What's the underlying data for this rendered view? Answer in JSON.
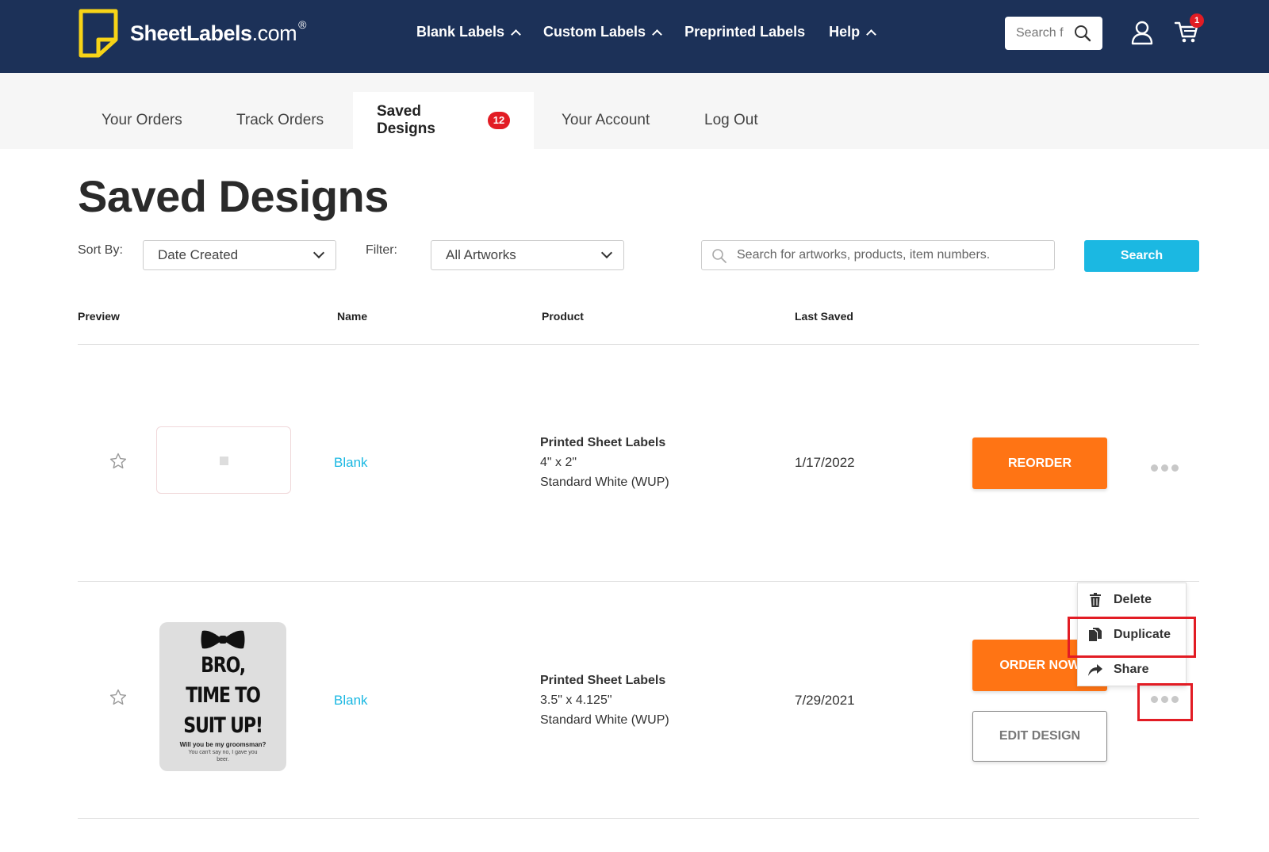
{
  "brand": {
    "name": "SheetLabels",
    "tld": ".com",
    "reg": "®"
  },
  "nav": [
    {
      "label": "Blank Labels",
      "caret": true
    },
    {
      "label": "Custom Labels",
      "caret": true
    },
    {
      "label": "Preprinted Labels",
      "caret": false
    },
    {
      "label": "Help",
      "caret": true
    }
  ],
  "header": {
    "search_placeholder": "Search f",
    "cart_count": "1"
  },
  "tabs": {
    "orders": "Your Orders",
    "track": "Track Orders",
    "saved": "Saved Designs",
    "saved_count": "12",
    "account": "Your Account",
    "logout": "Log Out"
  },
  "page": {
    "title": "Saved Designs"
  },
  "filters": {
    "sort_label": "Sort By:",
    "sort_value": "Date Created",
    "filter_label": "Filter:",
    "filter_value": "All Artworks",
    "search_placeholder": "Search for artworks, products, item numbers.",
    "search_button": "Search"
  },
  "table": {
    "headers": {
      "preview": "Preview",
      "name": "Name",
      "product": "Product",
      "last_saved": "Last Saved"
    },
    "rows": [
      {
        "name": "Blank",
        "product_title": "Printed Sheet Labels",
        "product_size": "4\" x 2\"",
        "product_material": "Standard White (WUP)",
        "last_saved": "1/17/2022",
        "primary_action": "REORDER"
      },
      {
        "name": "Blank",
        "product_title": "Printed Sheet Labels",
        "product_size": "3.5\" x 4.125\"",
        "product_material": "Standard White (WUP)",
        "last_saved": "7/29/2021",
        "primary_action": "ORDER NOW",
        "secondary_action": "EDIT DESIGN",
        "art": {
          "headline_1": "BRO,",
          "headline_2": "TIME TO",
          "headline_3": "SUIT UP!",
          "sub_1": "Will you be my groomsman?",
          "sub_2": "You can't say no, I gave you beer."
        }
      }
    ]
  },
  "menu": {
    "delete": "Delete",
    "duplicate": "Duplicate",
    "share": "Share"
  },
  "colors": {
    "header_bg": "#1c3158",
    "accent_cyan": "#1bb8e2",
    "order_orange": "#ff7414",
    "badge_red": "#e21c24",
    "logo_yellow": "#f7d417"
  }
}
